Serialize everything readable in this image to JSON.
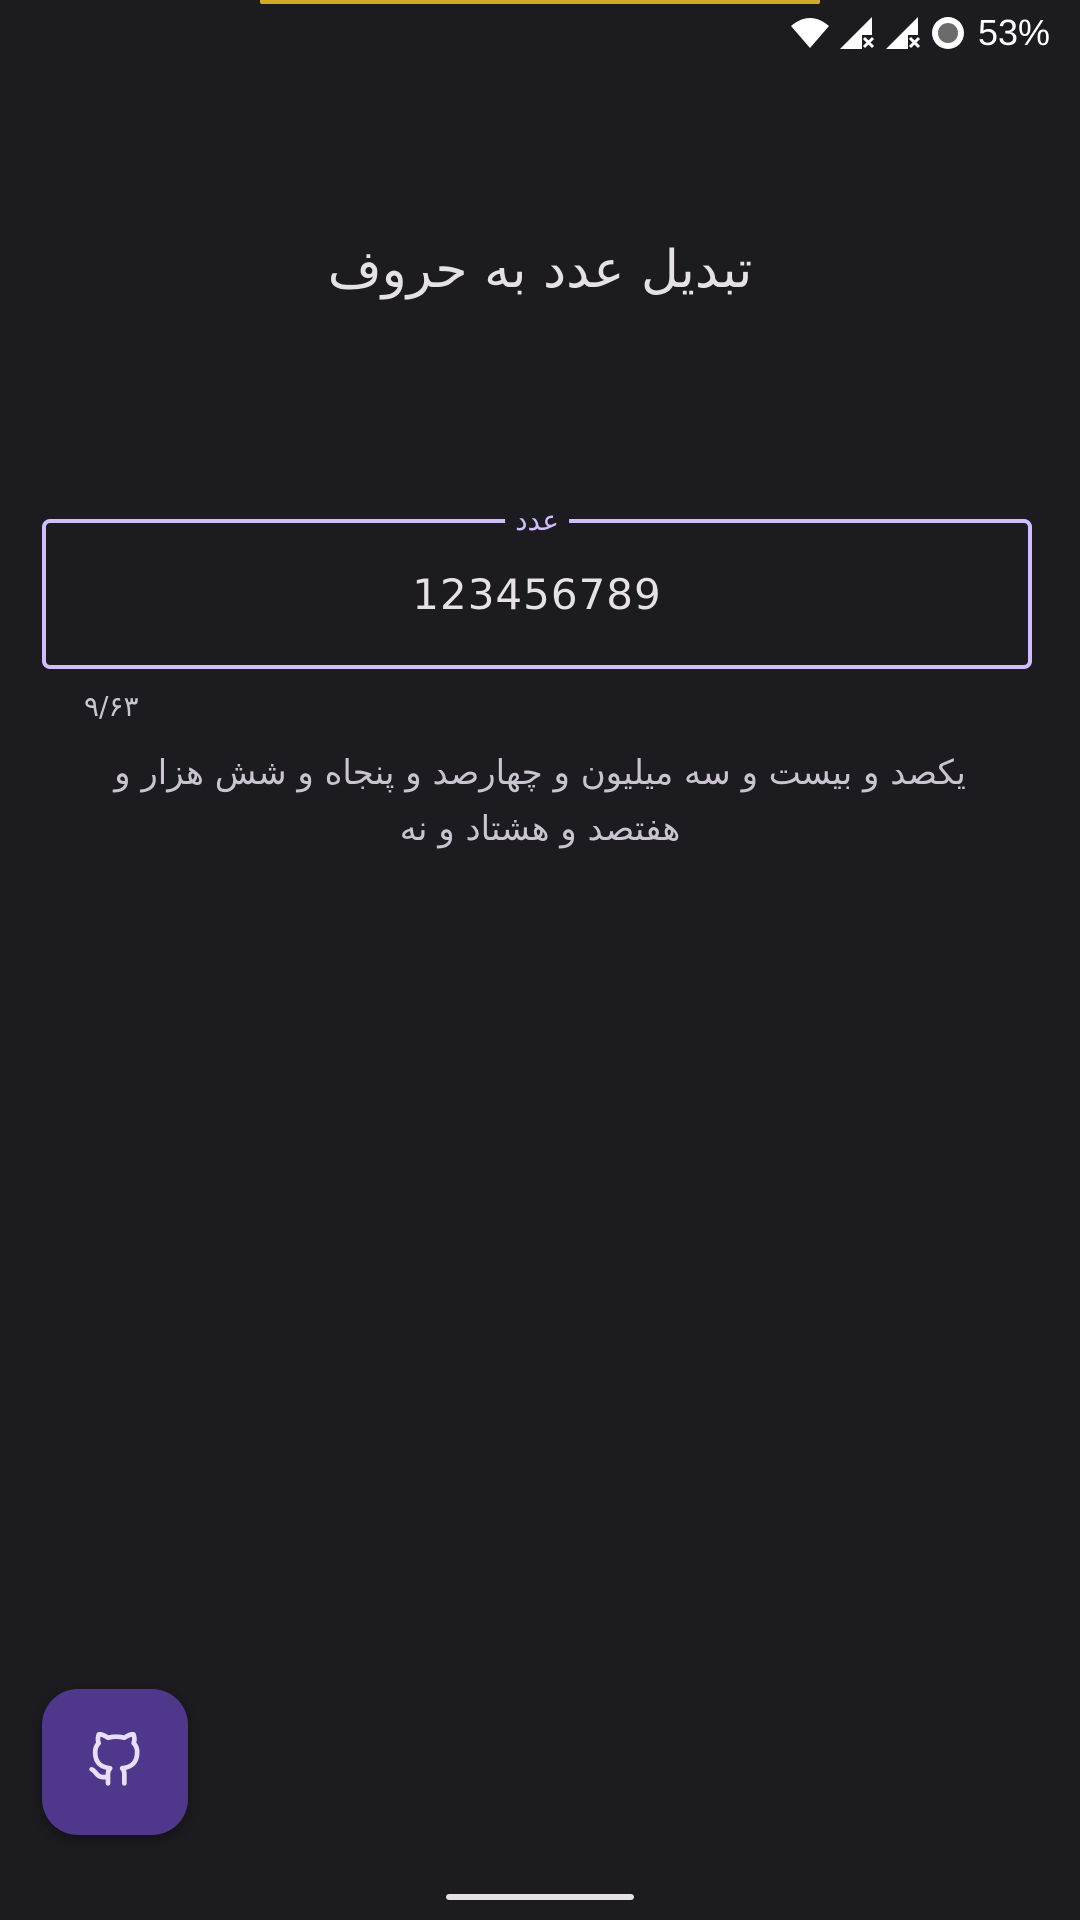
{
  "status_bar": {
    "battery_percent": "53%",
    "icons": [
      "wifi-icon",
      "signal-no-service-icon",
      "signal-no-service-icon",
      "record-dot-icon"
    ]
  },
  "app": {
    "title": "تبدیل عدد به حروف"
  },
  "number_field": {
    "label": "عدد",
    "value": "123456789"
  },
  "counter": "۹/۶۳",
  "result": "یکصد و بیست و سه میلیون  و چهارصد و پنجاه و شش هزار  و هفتصد و هشتاد و نه",
  "fab": {
    "icon": "github-icon"
  },
  "colors": {
    "background": "#1c1b20",
    "accent": "#d0bcff",
    "fab": "#4f378b",
    "top_accent": "#d4a82a"
  }
}
